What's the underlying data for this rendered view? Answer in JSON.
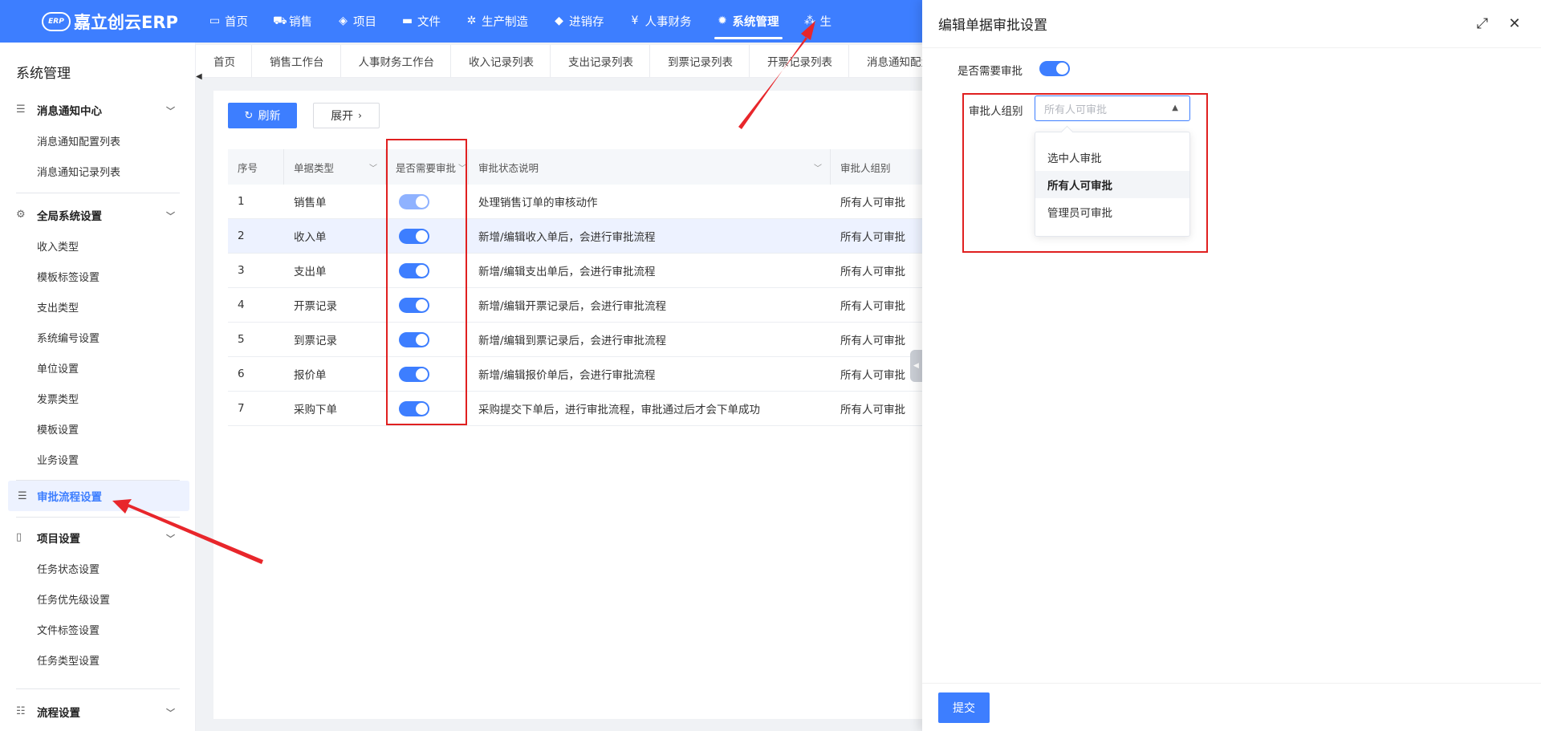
{
  "app": {
    "logo_text": "嘉立创云ERP",
    "logo_mark": "ERP"
  },
  "nav": [
    {
      "label": "首页",
      "icon": "monitor-icon"
    },
    {
      "label": "销售",
      "icon": "cart-icon"
    },
    {
      "label": "项目",
      "icon": "layers-icon"
    },
    {
      "label": "文件",
      "icon": "folder-icon"
    },
    {
      "label": "生产制造",
      "icon": "gear-puzzle-icon"
    },
    {
      "label": "进销存",
      "icon": "box-icon"
    },
    {
      "label": "人事财务",
      "icon": "finance-icon"
    },
    {
      "label": "系统管理",
      "icon": "settings-icon"
    },
    {
      "label": "生",
      "icon": "cluster-icon"
    }
  ],
  "sidebar": {
    "title": "系统管理",
    "groups": [
      {
        "label": "消息通知中心",
        "items": [
          "消息通知配置列表",
          "消息通知记录列表"
        ]
      },
      {
        "label": "全局系统设置",
        "items": [
          "收入类型",
          "模板标签设置",
          "支出类型",
          "系统编号设置",
          "单位设置",
          "发票类型",
          "模板设置",
          "业务设置"
        ]
      },
      {
        "label": "审批流程设置"
      },
      {
        "label": "项目设置",
        "items": [
          "任务状态设置",
          "任务优先级设置",
          "文件标签设置",
          "任务类型设置"
        ]
      },
      {
        "label": "流程设置"
      }
    ]
  },
  "tabs": [
    "首页",
    "销售工作台",
    "人事财务工作台",
    "收入记录列表",
    "支出记录列表",
    "到票记录列表",
    "开票记录列表",
    "消息通知配置"
  ],
  "toolbar": {
    "refresh_label": "刷新",
    "expand_label": "展开"
  },
  "table": {
    "headers": [
      "序号",
      "单据类型",
      "是否需要审批",
      "审批状态说明",
      "审批人组别"
    ],
    "rows": [
      {
        "index": "1",
        "type": "销售单",
        "desc": "处理销售订单的审核动作",
        "group": "所有人可审批"
      },
      {
        "index": "2",
        "type": "收入单",
        "desc": "新增/编辑收入单后，会进行审批流程",
        "group": "所有人可审批"
      },
      {
        "index": "3",
        "type": "支出单",
        "desc": "新增/编辑支出单后，会进行审批流程",
        "group": "所有人可审批"
      },
      {
        "index": "4",
        "type": "开票记录",
        "desc": "新增/编辑开票记录后，会进行审批流程",
        "group": "所有人可审批"
      },
      {
        "index": "5",
        "type": "到票记录",
        "desc": "新增/编辑到票记录后，会进行审批流程",
        "group": "所有人可审批"
      },
      {
        "index": "6",
        "type": "报价单",
        "desc": "新增/编辑报价单后，会进行审批流程",
        "group": "所有人可审批"
      },
      {
        "index": "7",
        "type": "采购下单",
        "desc": "采购提交下单后，进行审批流程，审批通过后才会下单成功",
        "group": "所有人可审批"
      }
    ]
  },
  "drawer": {
    "title": "编辑单据审批设置",
    "need_approval_label": "是否需要审批",
    "approver_group_label": "审批人组别",
    "select_placeholder": "所有人可审批",
    "options": [
      "选中人审批",
      "所有人可审批",
      "管理员可审批"
    ],
    "selected_option": "所有人可审批",
    "submit_label": "提交"
  },
  "colors": {
    "primary": "#3d7eff",
    "highlight": "#e02020"
  }
}
